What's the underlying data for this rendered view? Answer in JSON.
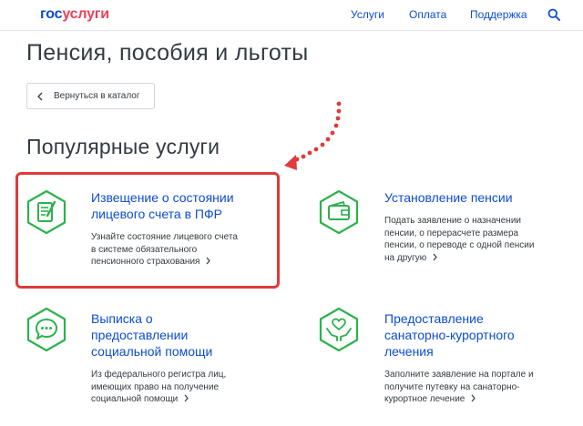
{
  "header": {
    "logo_part1": "гос",
    "logo_part2": "услуги",
    "nav": [
      {
        "label": "Услуги"
      },
      {
        "label": "Оплата"
      },
      {
        "label": "Поддержка"
      }
    ],
    "search_icon": "search-icon"
  },
  "page": {
    "title": "Пенсия, пособия и льготы",
    "back_label": "Вернуться в каталог",
    "section_title": "Популярные услуги"
  },
  "services": [
    {
      "icon": "document-edit-icon",
      "title_lines": [
        "Извещение о состоянии",
        "лицевого счета в ПФР"
      ],
      "desc_lines": [
        "Узнайте состояние лицевого счета",
        "в системе обязательного",
        "пенсионного страхования"
      ]
    },
    {
      "icon": "wallet-icon",
      "title_lines": [
        "Установление пенсии"
      ],
      "desc_lines": [
        "Подать заявление о назначении",
        "пенсии, о перерасчете размера",
        "пенсии, о переводе с одной пенсии",
        "на другую"
      ]
    },
    {
      "icon": "chat-bubble-icon",
      "title_lines": [
        "Выписка о",
        "предоставлении",
        "социальной помощи"
      ],
      "desc_lines": [
        "Из федерального регистра лиц,",
        "имеющих право на получение",
        "социальной помощи"
      ]
    },
    {
      "icon": "heart-hands-icon",
      "title_lines": [
        "Предоставление",
        "санаторно-курортного",
        "лечения"
      ],
      "desc_lines": [
        "Заполните заявление на портале и",
        "получите путевку на санаторно-",
        "курортное лечение"
      ]
    }
  ],
  "colors": {
    "link": "#0d4cd3",
    "logo_accent": "#ee3f58",
    "icon_green": "#2bb24c",
    "highlight": "#e03a3a"
  }
}
